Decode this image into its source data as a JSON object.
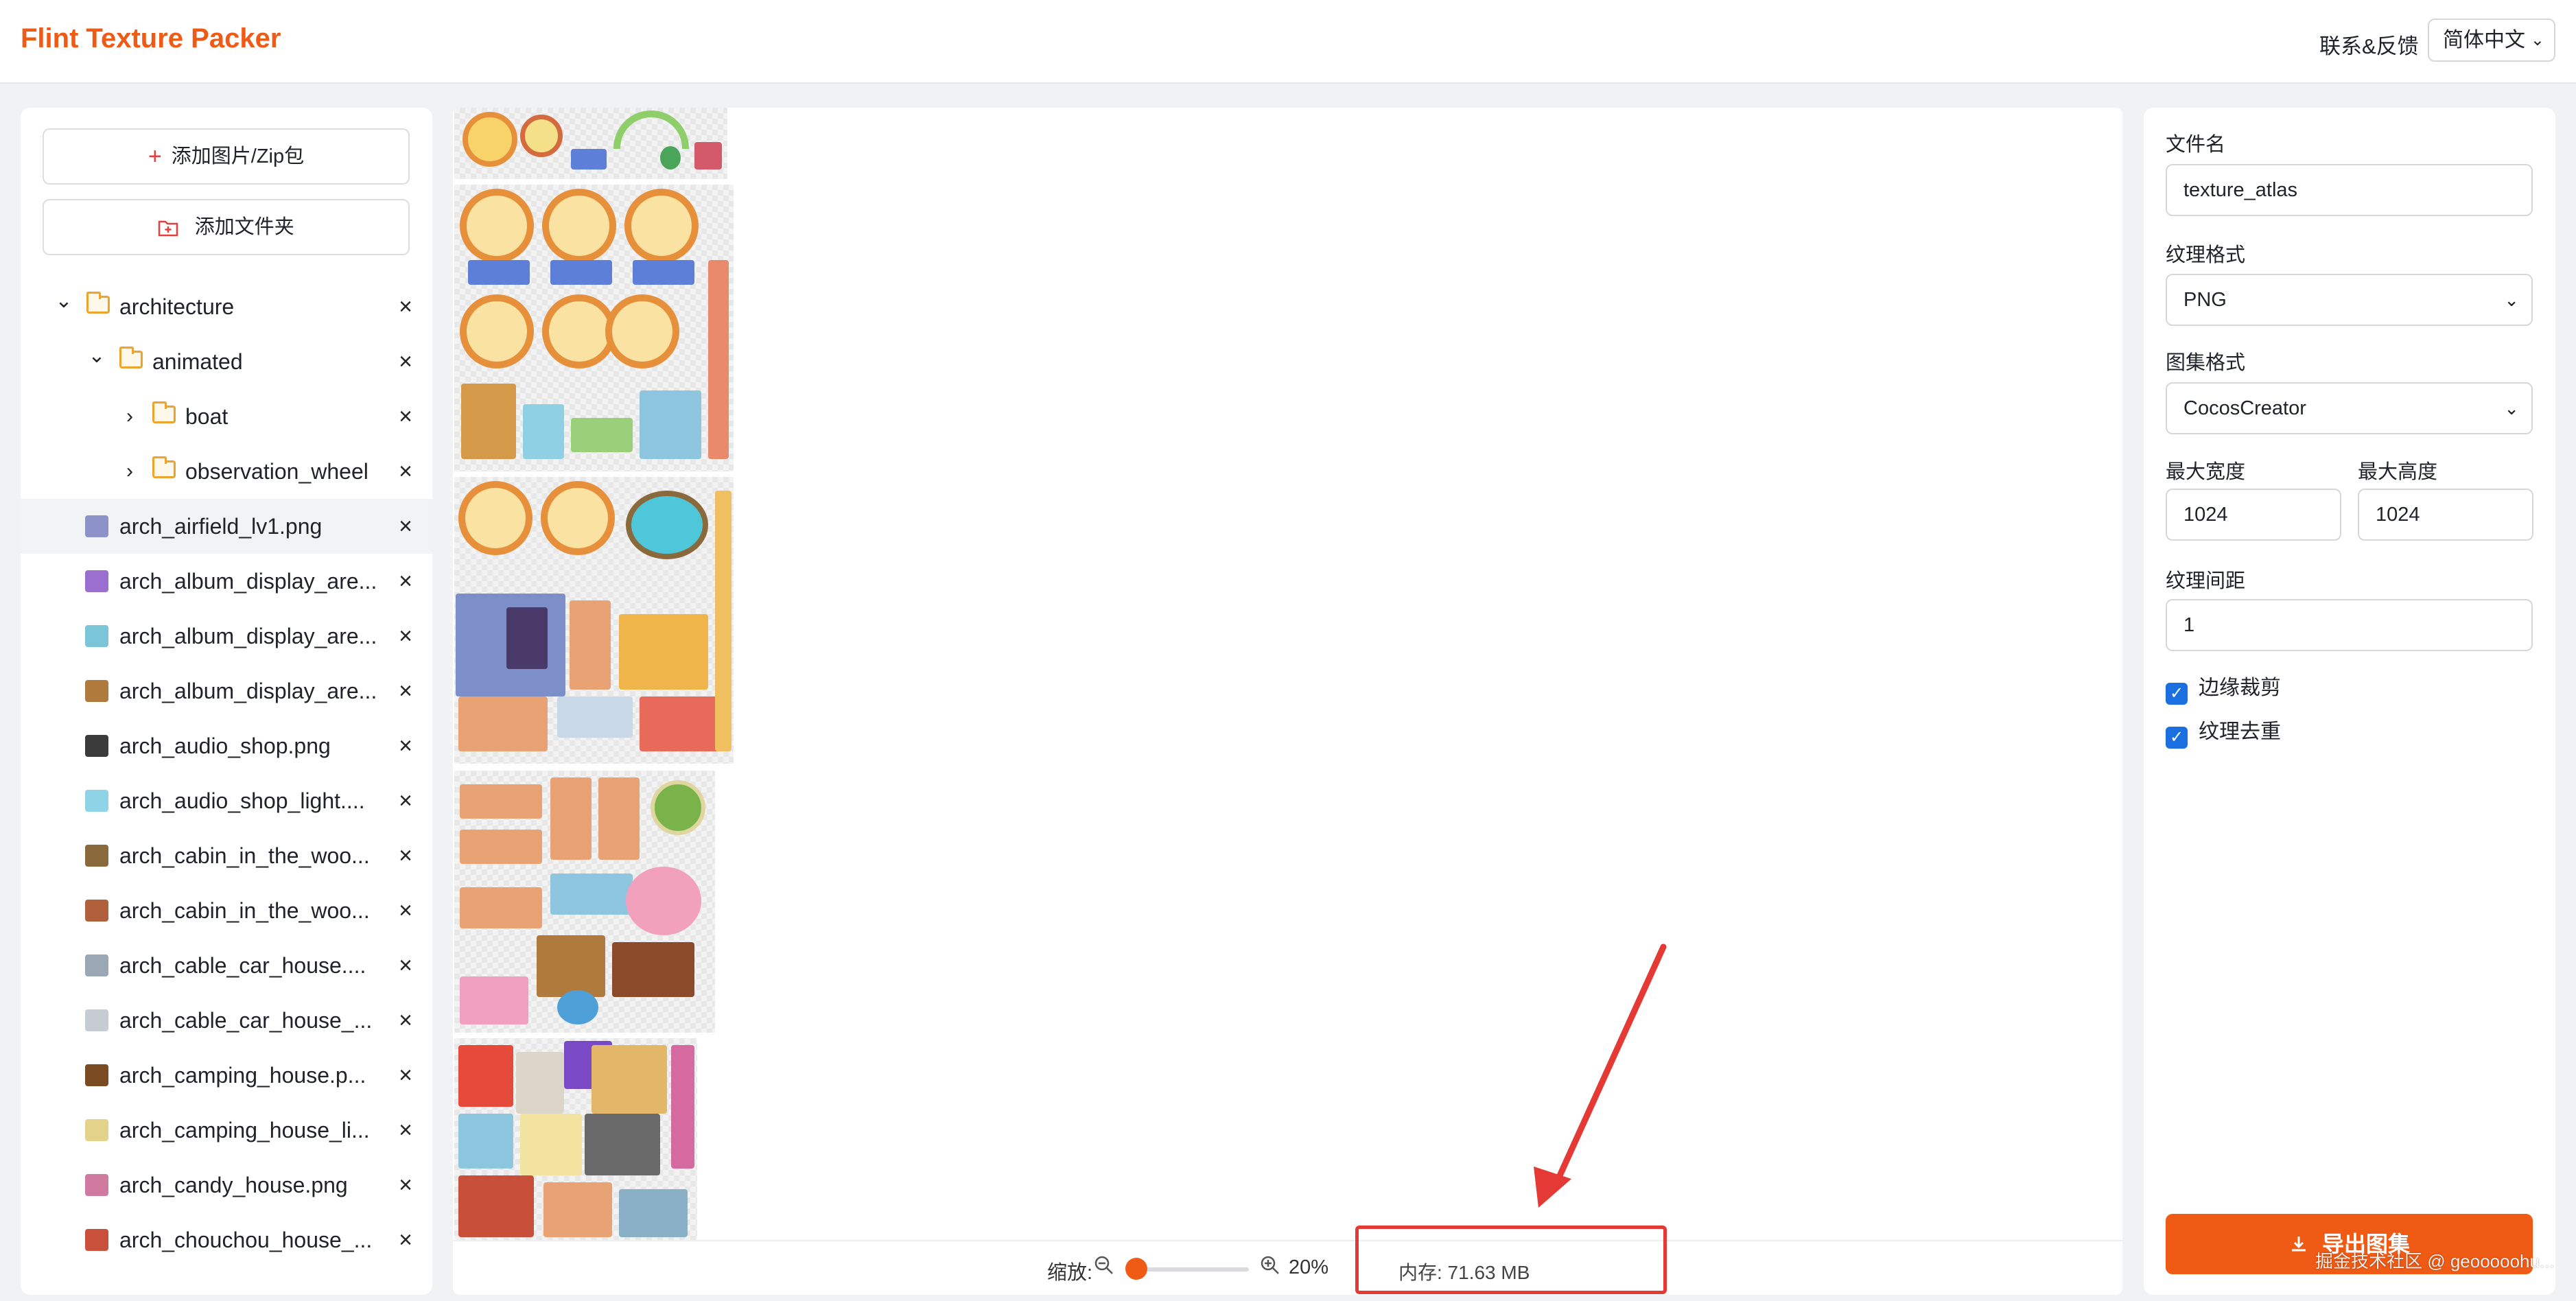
{
  "header": {
    "logo": "Flint Texture Packer",
    "feedback": "联系&反馈",
    "language": "简体中文"
  },
  "left": {
    "add_images": "添加图片/Zip包",
    "add_folder": "添加文件夹",
    "tree": [
      {
        "label": "architecture",
        "type": "folder",
        "expanded": true,
        "depth": 0
      },
      {
        "label": "animated",
        "type": "folder",
        "expanded": true,
        "depth": 1
      },
      {
        "label": "boat",
        "type": "folder",
        "expanded": false,
        "depth": 2
      },
      {
        "label": "observation_wheel",
        "type": "folder",
        "expanded": false,
        "depth": 2
      },
      {
        "label": "arch_airfield_lv1.png",
        "type": "file",
        "selected": true,
        "thumb": "#8d92c9"
      },
      {
        "label": "arch_album_display_are...",
        "type": "file",
        "thumb": "#9a6fd0"
      },
      {
        "label": "arch_album_display_are...",
        "type": "file",
        "thumb": "#7ac6d8"
      },
      {
        "label": "arch_album_display_are...",
        "type": "file",
        "thumb": "#b07a3c"
      },
      {
        "label": "arch_audio_shop.png",
        "type": "file",
        "thumb": "#3b3b3b"
      },
      {
        "label": "arch_audio_shop_light....",
        "type": "file",
        "thumb": "#8fd3e6"
      },
      {
        "label": "arch_cabin_in_the_woo...",
        "type": "file",
        "thumb": "#8a6a3c"
      },
      {
        "label": "arch_cabin_in_the_woo...",
        "type": "file",
        "thumb": "#b0603a"
      },
      {
        "label": "arch_cable_car_house....",
        "type": "file",
        "thumb": "#9aa7b4"
      },
      {
        "label": "arch_cable_car_house_...",
        "type": "file",
        "thumb": "#c7ccd3"
      },
      {
        "label": "arch_camping_house.p...",
        "type": "file",
        "thumb": "#7a4a22"
      },
      {
        "label": "arch_camping_house_li...",
        "type": "file",
        "thumb": "#e3d38a"
      },
      {
        "label": "arch_candy_house.png",
        "type": "file",
        "thumb": "#d07aa0"
      },
      {
        "label": "arch_chouchou_house_...",
        "type": "file",
        "thumb": "#c9503a"
      }
    ]
  },
  "canvas": {
    "zoom_label": "缩放:",
    "zoom_value": "20%",
    "zoom_fraction": 0.2,
    "memory": "内存: 71.63 MB"
  },
  "settings": {
    "filename_label": "文件名",
    "filename_value": "texture_atlas",
    "texture_format_label": "纹理格式",
    "texture_format_value": "PNG",
    "atlas_format_label": "图集格式",
    "atlas_format_value": "CocosCreator",
    "max_width_label": "最大宽度",
    "max_width_value": "1024",
    "max_height_label": "最大高度",
    "max_height_value": "1024",
    "padding_label": "纹理间距",
    "padding_value": "1",
    "trim_label": "边缘裁剪",
    "trim_checked": true,
    "dedupe_label": "纹理去重",
    "dedupe_checked": true,
    "export_label": "导出图集"
  },
  "watermark": "掘金技术社区 @ geooooohu...",
  "colors": {
    "accent": "#ef5a14",
    "checkbox": "#1c6fe0",
    "annotation": "#e53935"
  }
}
